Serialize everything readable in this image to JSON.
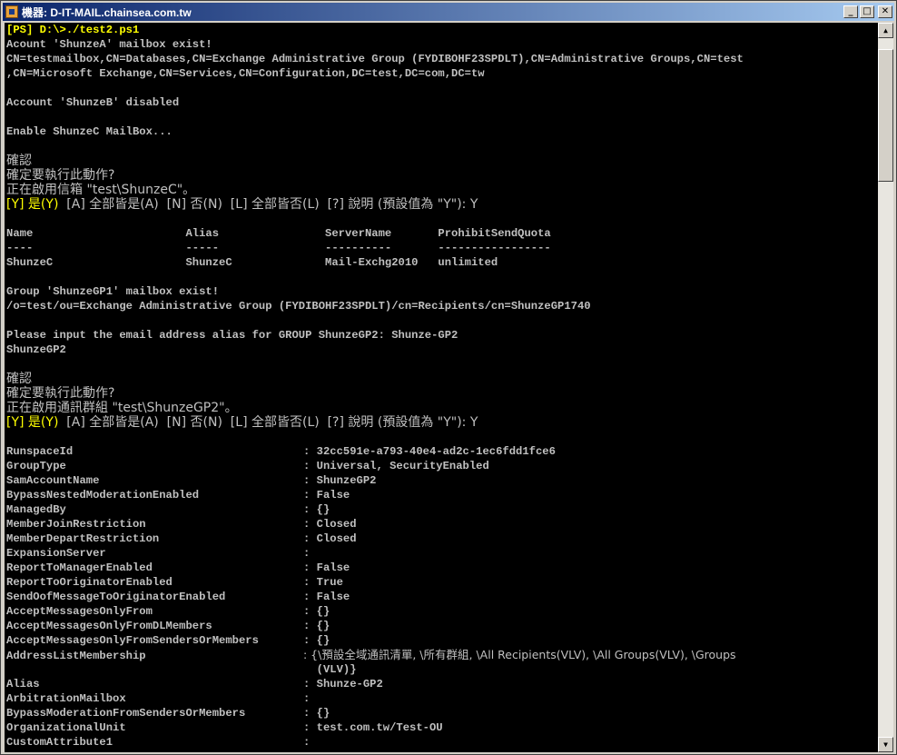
{
  "window": {
    "title": "機器: D-IT-MAIL.chainsea.com.tw"
  },
  "titlebar_buttons": {
    "minimize": "_",
    "maximize": "□",
    "close": "✕"
  },
  "scrollbar": {
    "up_arrow": "▲",
    "down_arrow": "▼",
    "thumb_position": 0.02,
    "thumb_fraction": 0.19
  },
  "colors": {
    "console_bg": "#000000",
    "console_text": "#c0c0c0",
    "highlight": "#ffff00",
    "titlebar": "#0a246a"
  },
  "console": {
    "prompt": "[PS] D:\\>./test2.ps1",
    "l1": "Acount 'ShunzeA' mailbox exist!",
    "l2": "CN=testmailbox,CN=Databases,CN=Exchange Administrative Group (FYDIBOHF23SPDLT),CN=Administrative Groups,CN=test",
    "l3": ",CN=Microsoft Exchange,CN=Services,CN=Configuration,DC=test,DC=com,DC=tw",
    "l4": "Account 'ShunzeB' disabled",
    "l5": "Enable ShunzeC MailBox...",
    "confirm1": {
      "title": "確認",
      "question": "確定要執行此動作?",
      "action": "正在啟用信箱 \"test\\ShunzeC\"。",
      "yes": "[Y] 是(Y)",
      "rest": "  [A] 全部皆是(A)  [N] 否(N)  [L] 全部皆否(L)  [?] 說明 (預設值為 \"Y\"): Y"
    },
    "table_header": "Name                       Alias                ServerName       ProhibitSendQuota",
    "table_sep": "----                       -----                ----------       -----------------",
    "table_row": "ShunzeC                    ShunzeC              Mail-Exchg2010   unlimited",
    "l6": "Group 'ShunzeGP1' mailbox exist!",
    "l7": "/o=test/ou=Exchange Administrative Group (FYDIBOHF23SPDLT)/cn=Recipients/cn=ShunzeGP1740",
    "l8": "Please input the email address alias for GROUP ShunzeGP2: Shunze-GP2",
    "l9": "ShunzeGP2",
    "confirm2": {
      "title": "確認",
      "question": "確定要執行此動作?",
      "action": "正在啟用通訊群組 \"test\\ShunzeGP2\"。",
      "yes": "[Y] 是(Y)",
      "rest": "  [A] 全部皆是(A)  [N] 否(N)  [L] 全部皆否(L)  [?] 說明 (預設值為 \"Y\"): Y"
    },
    "props": [
      {
        "key": "RunspaceId",
        "value": ": 32cc591e-a793-40e4-ad2c-1ec6fdd1fce6"
      },
      {
        "key": "GroupType",
        "value": ": Universal, SecurityEnabled"
      },
      {
        "key": "SamAccountName",
        "value": ": ShunzeGP2"
      },
      {
        "key": "BypassNestedModerationEnabled",
        "value": ": False"
      },
      {
        "key": "ManagedBy",
        "value": ": {}"
      },
      {
        "key": "MemberJoinRestriction",
        "value": ": Closed"
      },
      {
        "key": "MemberDepartRestriction",
        "value": ": Closed"
      },
      {
        "key": "ExpansionServer",
        "value": ":"
      },
      {
        "key": "ReportToManagerEnabled",
        "value": ": False"
      },
      {
        "key": "ReportToOriginatorEnabled",
        "value": ": True"
      },
      {
        "key": "SendOofMessageToOriginatorEnabled",
        "value": ": False"
      },
      {
        "key": "AcceptMessagesOnlyFrom",
        "value": ": {}"
      },
      {
        "key": "AcceptMessagesOnlyFromDLMembers",
        "value": ": {}"
      },
      {
        "key": "AcceptMessagesOnlyFromSendersOrMembers",
        "value": ": {}"
      },
      {
        "key": "AddressListMembership",
        "value": ": {\\預設全域通訊清單, \\所有群組, \\All Recipients(VLV), \\All Groups(VLV), \\Groups"
      },
      {
        "key": "",
        "value": "  (VLV)}"
      },
      {
        "key": "Alias",
        "value": ": Shunze-GP2"
      },
      {
        "key": "ArbitrationMailbox",
        "value": ":"
      },
      {
        "key": "BypassModerationFromSendersOrMembers",
        "value": ": {}"
      },
      {
        "key": "OrganizationalUnit",
        "value": ": test.com.tw/Test-OU"
      },
      {
        "key": "CustomAttribute1",
        "value": ":"
      }
    ]
  }
}
